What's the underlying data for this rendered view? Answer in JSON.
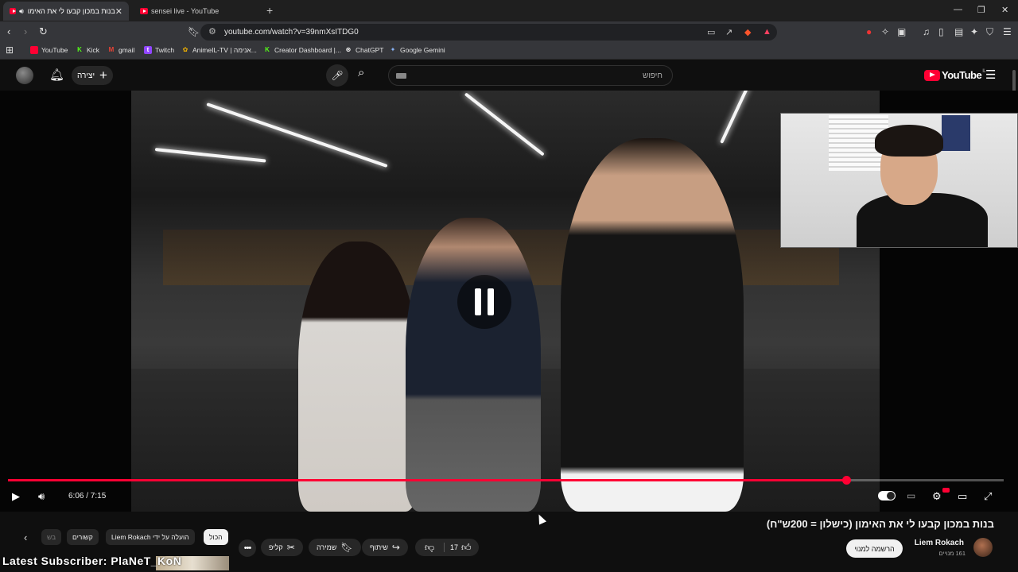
{
  "browser": {
    "tabs": [
      {
        "label": "בנות במכון קבעו לי את האימו",
        "active": true
      },
      {
        "label": "sensei live - YouTube",
        "active": false
      }
    ],
    "url": "youtube.com/watch?v=39nmXsITDG0",
    "bookmarks": [
      {
        "label": "YouTube",
        "color": "#ff0033"
      },
      {
        "label": "Kick",
        "color": "#53fc18"
      },
      {
        "label": "gmail",
        "color": "#ea4335"
      },
      {
        "label": "Twitch",
        "color": "#9146ff"
      },
      {
        "label": "AnimeIL-TV | אנימה...",
        "color": "#f4b400"
      },
      {
        "label": "Creator Dashboard |...",
        "color": "#53fc18"
      },
      {
        "label": "ChatGPT",
        "color": "#ffffff"
      },
      {
        "label": "Google Gemini",
        "color": "#8ab4f8"
      }
    ]
  },
  "youtube": {
    "create_label": "יצירה",
    "search_placeholder": "חיפוש",
    "logo_text": "YouTube",
    "logo_region": "IL"
  },
  "player": {
    "current_time": "6:06",
    "duration": "7:15",
    "time_display": "6:06 / 7:15",
    "progress_fraction": 0.842,
    "state": "paused"
  },
  "video": {
    "title": "בנות במכון קבעו לי את האימון (כישלון = 200ש\"ח)",
    "channel_name": "Liem Rokach",
    "subscribers": "161 מנויים",
    "subscribe_label": "הרשמה למנוי",
    "likes": "17",
    "share_label": "שיתוף",
    "save_label": "שמירה",
    "clip_label": "קליפ"
  },
  "chips": [
    {
      "label": "הכול",
      "selected": true
    },
    {
      "label": "הועלה על ידי Liem Rokach",
      "selected": false
    },
    {
      "label": "קשורים",
      "selected": false
    },
    {
      "label": "בש",
      "selected": false
    }
  ],
  "overlay": {
    "latest_subscriber": "Latest Subscriber: PlaNeT_KoN"
  }
}
